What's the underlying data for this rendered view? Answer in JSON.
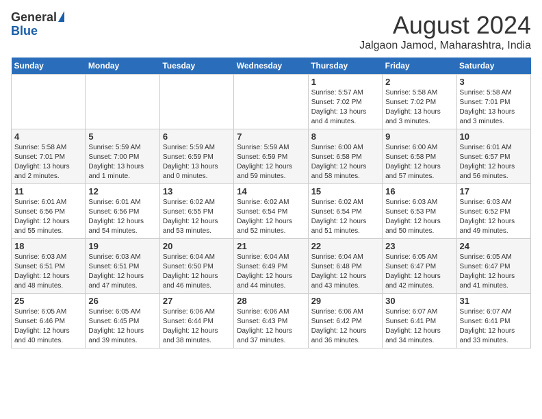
{
  "header": {
    "logo_general": "General",
    "logo_blue": "Blue",
    "month": "August 2024",
    "location": "Jalgaon Jamod, Maharashtra, India"
  },
  "days_of_week": [
    "Sunday",
    "Monday",
    "Tuesday",
    "Wednesday",
    "Thursday",
    "Friday",
    "Saturday"
  ],
  "weeks": [
    [
      {
        "num": "",
        "sunrise": "",
        "sunset": "",
        "daylight": ""
      },
      {
        "num": "",
        "sunrise": "",
        "sunset": "",
        "daylight": ""
      },
      {
        "num": "",
        "sunrise": "",
        "sunset": "",
        "daylight": ""
      },
      {
        "num": "",
        "sunrise": "",
        "sunset": "",
        "daylight": ""
      },
      {
        "num": "1",
        "sunrise": "Sunrise: 5:57 AM",
        "sunset": "Sunset: 7:02 PM",
        "daylight": "Daylight: 13 hours and 4 minutes."
      },
      {
        "num": "2",
        "sunrise": "Sunrise: 5:58 AM",
        "sunset": "Sunset: 7:02 PM",
        "daylight": "Daylight: 13 hours and 3 minutes."
      },
      {
        "num": "3",
        "sunrise": "Sunrise: 5:58 AM",
        "sunset": "Sunset: 7:01 PM",
        "daylight": "Daylight: 13 hours and 3 minutes."
      }
    ],
    [
      {
        "num": "4",
        "sunrise": "Sunrise: 5:58 AM",
        "sunset": "Sunset: 7:01 PM",
        "daylight": "Daylight: 13 hours and 2 minutes."
      },
      {
        "num": "5",
        "sunrise": "Sunrise: 5:59 AM",
        "sunset": "Sunset: 7:00 PM",
        "daylight": "Daylight: 13 hours and 1 minute."
      },
      {
        "num": "6",
        "sunrise": "Sunrise: 5:59 AM",
        "sunset": "Sunset: 6:59 PM",
        "daylight": "Daylight: 13 hours and 0 minutes."
      },
      {
        "num": "7",
        "sunrise": "Sunrise: 5:59 AM",
        "sunset": "Sunset: 6:59 PM",
        "daylight": "Daylight: 12 hours and 59 minutes."
      },
      {
        "num": "8",
        "sunrise": "Sunrise: 6:00 AM",
        "sunset": "Sunset: 6:58 PM",
        "daylight": "Daylight: 12 hours and 58 minutes."
      },
      {
        "num": "9",
        "sunrise": "Sunrise: 6:00 AM",
        "sunset": "Sunset: 6:58 PM",
        "daylight": "Daylight: 12 hours and 57 minutes."
      },
      {
        "num": "10",
        "sunrise": "Sunrise: 6:01 AM",
        "sunset": "Sunset: 6:57 PM",
        "daylight": "Daylight: 12 hours and 56 minutes."
      }
    ],
    [
      {
        "num": "11",
        "sunrise": "Sunrise: 6:01 AM",
        "sunset": "Sunset: 6:56 PM",
        "daylight": "Daylight: 12 hours and 55 minutes."
      },
      {
        "num": "12",
        "sunrise": "Sunrise: 6:01 AM",
        "sunset": "Sunset: 6:56 PM",
        "daylight": "Daylight: 12 hours and 54 minutes."
      },
      {
        "num": "13",
        "sunrise": "Sunrise: 6:02 AM",
        "sunset": "Sunset: 6:55 PM",
        "daylight": "Daylight: 12 hours and 53 minutes."
      },
      {
        "num": "14",
        "sunrise": "Sunrise: 6:02 AM",
        "sunset": "Sunset: 6:54 PM",
        "daylight": "Daylight: 12 hours and 52 minutes."
      },
      {
        "num": "15",
        "sunrise": "Sunrise: 6:02 AM",
        "sunset": "Sunset: 6:54 PM",
        "daylight": "Daylight: 12 hours and 51 minutes."
      },
      {
        "num": "16",
        "sunrise": "Sunrise: 6:03 AM",
        "sunset": "Sunset: 6:53 PM",
        "daylight": "Daylight: 12 hours and 50 minutes."
      },
      {
        "num": "17",
        "sunrise": "Sunrise: 6:03 AM",
        "sunset": "Sunset: 6:52 PM",
        "daylight": "Daylight: 12 hours and 49 minutes."
      }
    ],
    [
      {
        "num": "18",
        "sunrise": "Sunrise: 6:03 AM",
        "sunset": "Sunset: 6:51 PM",
        "daylight": "Daylight: 12 hours and 48 minutes."
      },
      {
        "num": "19",
        "sunrise": "Sunrise: 6:03 AM",
        "sunset": "Sunset: 6:51 PM",
        "daylight": "Daylight: 12 hours and 47 minutes."
      },
      {
        "num": "20",
        "sunrise": "Sunrise: 6:04 AM",
        "sunset": "Sunset: 6:50 PM",
        "daylight": "Daylight: 12 hours and 46 minutes."
      },
      {
        "num": "21",
        "sunrise": "Sunrise: 6:04 AM",
        "sunset": "Sunset: 6:49 PM",
        "daylight": "Daylight: 12 hours and 44 minutes."
      },
      {
        "num": "22",
        "sunrise": "Sunrise: 6:04 AM",
        "sunset": "Sunset: 6:48 PM",
        "daylight": "Daylight: 12 hours and 43 minutes."
      },
      {
        "num": "23",
        "sunrise": "Sunrise: 6:05 AM",
        "sunset": "Sunset: 6:47 PM",
        "daylight": "Daylight: 12 hours and 42 minutes."
      },
      {
        "num": "24",
        "sunrise": "Sunrise: 6:05 AM",
        "sunset": "Sunset: 6:47 PM",
        "daylight": "Daylight: 12 hours and 41 minutes."
      }
    ],
    [
      {
        "num": "25",
        "sunrise": "Sunrise: 6:05 AM",
        "sunset": "Sunset: 6:46 PM",
        "daylight": "Daylight: 12 hours and 40 minutes."
      },
      {
        "num": "26",
        "sunrise": "Sunrise: 6:05 AM",
        "sunset": "Sunset: 6:45 PM",
        "daylight": "Daylight: 12 hours and 39 minutes."
      },
      {
        "num": "27",
        "sunrise": "Sunrise: 6:06 AM",
        "sunset": "Sunset: 6:44 PM",
        "daylight": "Daylight: 12 hours and 38 minutes."
      },
      {
        "num": "28",
        "sunrise": "Sunrise: 6:06 AM",
        "sunset": "Sunset: 6:43 PM",
        "daylight": "Daylight: 12 hours and 37 minutes."
      },
      {
        "num": "29",
        "sunrise": "Sunrise: 6:06 AM",
        "sunset": "Sunset: 6:42 PM",
        "daylight": "Daylight: 12 hours and 36 minutes."
      },
      {
        "num": "30",
        "sunrise": "Sunrise: 6:07 AM",
        "sunset": "Sunset: 6:41 PM",
        "daylight": "Daylight: 12 hours and 34 minutes."
      },
      {
        "num": "31",
        "sunrise": "Sunrise: 6:07 AM",
        "sunset": "Sunset: 6:41 PM",
        "daylight": "Daylight: 12 hours and 33 minutes."
      }
    ]
  ]
}
